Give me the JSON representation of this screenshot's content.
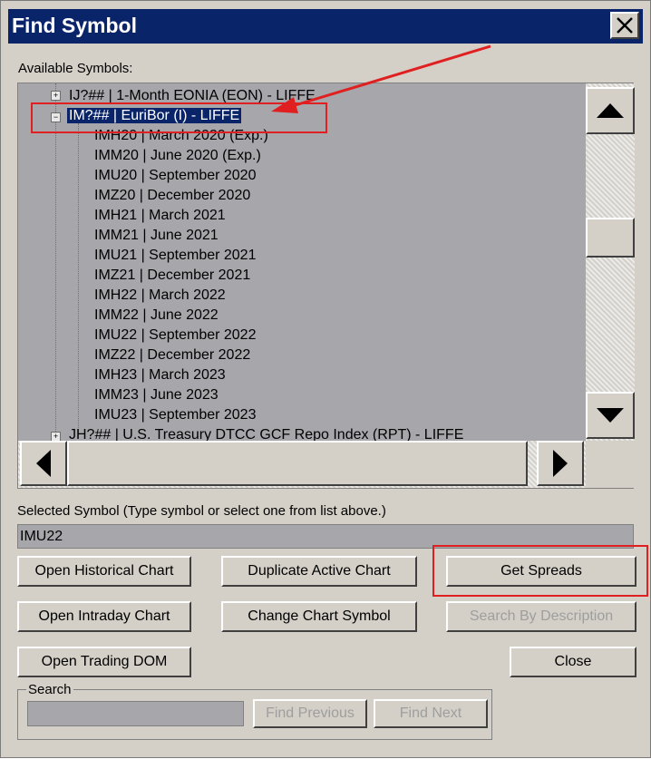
{
  "window": {
    "title": "Find Symbol",
    "close_icon": "close-icon"
  },
  "tree": {
    "label": "Available Symbols:",
    "top_partial": "IJ?##  |  1-Month EONIA (EON) - LIFFE",
    "selected_parent": "IM?##  |  EuriBor (I) - LIFFE",
    "children": [
      "IMH20  |  March 2020 (Exp.)",
      "IMM20  |  June 2020 (Exp.)",
      "IMU20  |  September 2020",
      "IMZ20  |  December 2020",
      "IMH21  |  March 2021",
      "IMM21  |  June 2021",
      "IMU21  |  September 2021",
      "IMZ21  |  December 2021",
      "IMH22  |  March 2022",
      "IMM22  |  June 2022",
      "IMU22  |  September 2022",
      "IMZ22  |  December 2022",
      "IMH23  |  March 2023",
      "IMM23  |  June 2023",
      "IMU23  |  September 2023"
    ],
    "bottom_partial": "JH?##  |  U.S. Treasury DTCC GCF Repo Index (RPT) - LIFFE"
  },
  "selected_symbol": {
    "label": "Selected Symbol (Type symbol or select one from list above.)",
    "value": "IMU22"
  },
  "buttons": {
    "open_historical_chart": "Open Historical Chart",
    "duplicate_active_chart": "Duplicate Active Chart",
    "get_spreads": "Get Spreads",
    "open_intraday_chart": "Open Intraday Chart",
    "change_chart_symbol": "Change Chart Symbol",
    "search_by_description": "Search By Description",
    "open_trading_dom": "Open Trading DOM",
    "close": "Close"
  },
  "search": {
    "label": "Search",
    "value": "",
    "find_previous": "Find Previous",
    "find_next": "Find Next"
  },
  "colors": {
    "title_bar": "#0a246a",
    "selection": "#0a246a",
    "annotation_red": "#e02020",
    "list_background": "#a7a6ab"
  }
}
